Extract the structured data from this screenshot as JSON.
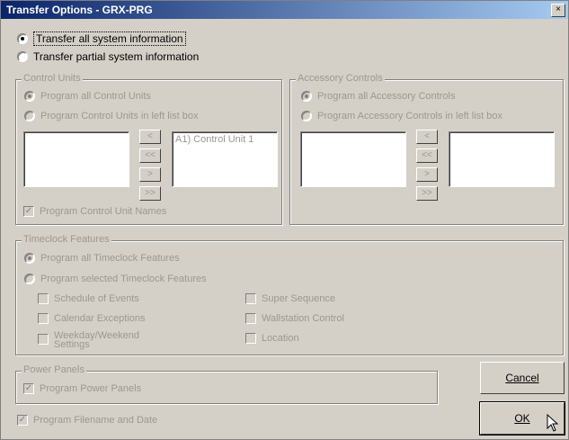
{
  "window": {
    "title": "Transfer Options - GRX-PRG",
    "close_label": "×"
  },
  "transfer": {
    "all_label": "Transfer all system information",
    "partial_label": "Transfer partial system information"
  },
  "control_units": {
    "group_label": "Control Units",
    "program_all_label": "Program all Control Units",
    "program_in_list_label": "Program Control Units in left list box",
    "right_list": [
      "A1) Control Unit 1"
    ],
    "names_label": "Program Control Unit Names"
  },
  "accessory": {
    "group_label": "Accessory Controls",
    "program_all_label": "Program all Accessory Controls",
    "program_in_list_label": "Program Accessory Controls in left list box"
  },
  "arrows": {
    "left": "<",
    "all_left": "<<",
    "right": ">",
    "all_right": ">>"
  },
  "timeclock": {
    "group_label": "Timeclock Features",
    "program_all_label": "Program all Timeclock Features",
    "program_selected_label": "Program selected Timeclock Features",
    "schedule_label": "Schedule of Events",
    "calendar_label": "Calendar Exceptions",
    "weekday_label": "Weekday/Weekend Settings",
    "super_label": "Super Sequence",
    "wallstation_label": "Wallstation Control",
    "location_label": "Location"
  },
  "power": {
    "group_label": "Power Panels",
    "program_label": "Program Power Panels"
  },
  "filename_label": "Program Filename and Date",
  "buttons": {
    "cancel": "Cancel",
    "ok": "OK"
  }
}
